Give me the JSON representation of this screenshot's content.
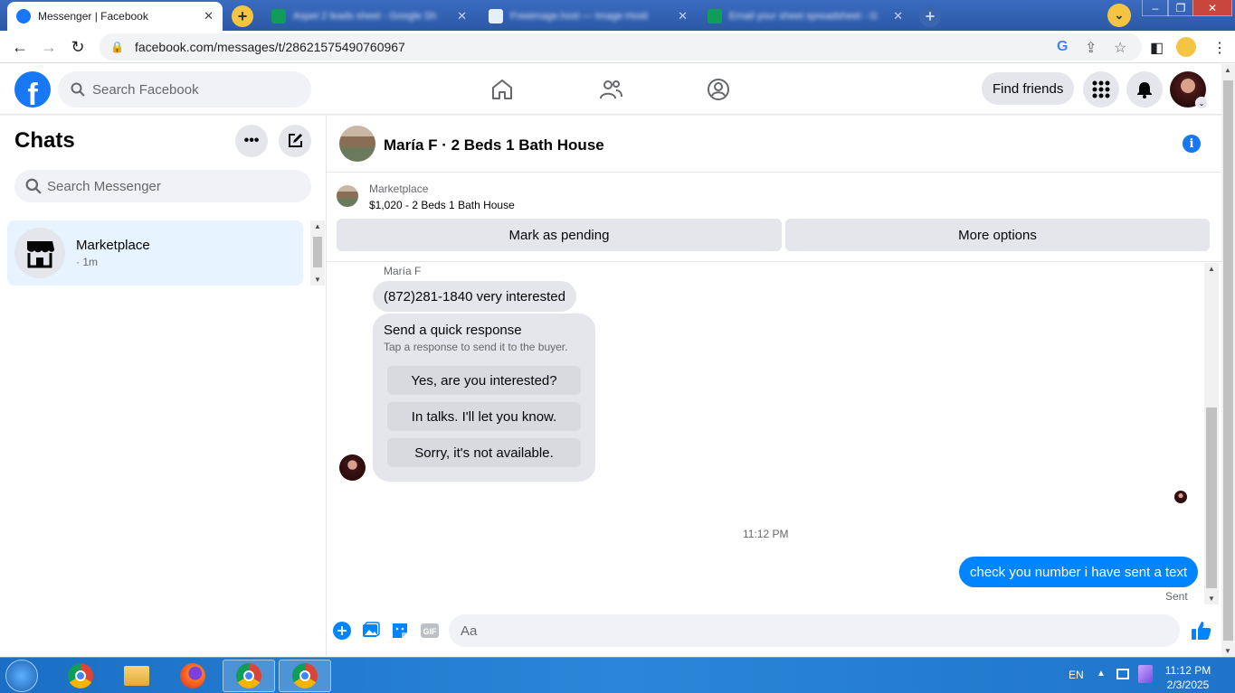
{
  "browser": {
    "tabs": [
      {
        "title": "Messenger | Facebook",
        "active": true
      },
      {
        "title": "Aspet 2 leads sheet - Google Sh",
        "active": false
      },
      {
        "title": "Freeimage.host — Image Hosti",
        "active": false
      },
      {
        "title": "Email your sheet spreadsheet - G",
        "active": false
      }
    ],
    "url": "facebook.com/messages/t/28621575490760967"
  },
  "header": {
    "search_placeholder": "Search Facebook",
    "find_friends": "Find friends"
  },
  "sidebar": {
    "title": "Chats",
    "search_placeholder": "Search Messenger",
    "chats": [
      {
        "name": "Marketplace",
        "time": "· 1m"
      }
    ]
  },
  "conversation": {
    "title": "María F · 2 Beds 1 Bath House",
    "marketplace": {
      "label": "Marketplace",
      "listing": "$1,020 - 2 Beds 1 Bath House",
      "mark_pending": "Mark as pending",
      "more_options": "More options"
    },
    "sender_name": "María F",
    "incoming_message": "(872)281-1840 very interested",
    "quick_response": {
      "title": "Send a quick response",
      "subtitle": "Tap a response to send it to the buyer.",
      "options": [
        "Yes, are you interested?",
        "In talks. I'll let you know.",
        "Sorry, it's not available."
      ]
    },
    "timestamp": "11:12 PM",
    "outgoing_message": "check you number i have sent a text",
    "status": "Sent",
    "composer_placeholder": "Aa"
  },
  "taskbar": {
    "language": "EN",
    "time": "11:12 PM",
    "date": "2/3/2025"
  },
  "colors": {
    "fb_blue": "#1877f2",
    "messenger_blue": "#0084ff"
  }
}
